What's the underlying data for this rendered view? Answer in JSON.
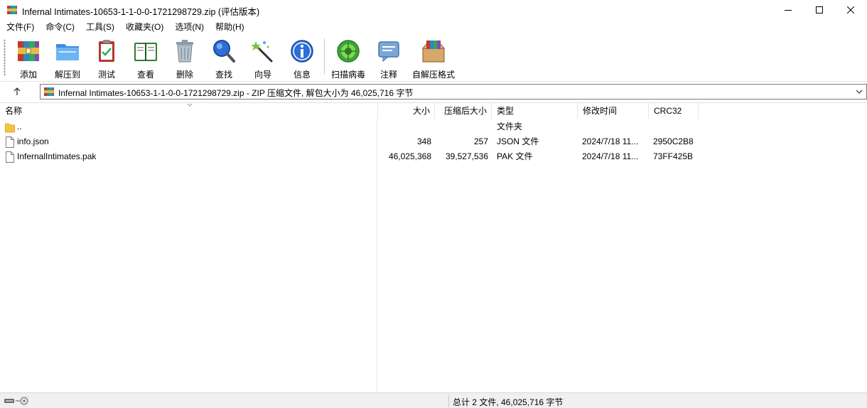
{
  "window": {
    "title": "Infernal Intimates-10653-1-1-0-0-1721298729.zip (评估版本)",
    "app_icon": "winrar-icon",
    "controls": [
      "minimize-icon",
      "maximize-icon",
      "close-icon"
    ]
  },
  "menu": [
    {
      "label": "文件(F)"
    },
    {
      "label": "命令(C)"
    },
    {
      "label": "工具(S)"
    },
    {
      "label": "收藏夹(O)"
    },
    {
      "label": "选项(N)"
    },
    {
      "label": "帮助(H)"
    }
  ],
  "toolbar": {
    "buttons": [
      {
        "label": "添加",
        "icon": "add-archive-icon"
      },
      {
        "label": "解压到",
        "icon": "extract-folder-icon"
      },
      {
        "label": "测试",
        "icon": "test-clipboard-icon"
      },
      {
        "label": "查看",
        "icon": "view-book-icon"
      },
      {
        "label": "删除",
        "icon": "delete-trash-icon"
      },
      {
        "label": "查找",
        "icon": "find-magnifier-icon"
      },
      {
        "label": "向导",
        "icon": "wizard-wand-icon"
      },
      {
        "label": "信息",
        "icon": "info-icon"
      },
      {
        "label": "扫描病毒",
        "icon": "virus-scan-icon"
      },
      {
        "label": "注释",
        "icon": "comment-icon"
      },
      {
        "label": "自解压格式",
        "icon": "sfx-box-icon"
      }
    ]
  },
  "address": {
    "text": "Infernal Intimates-10653-1-1-0-0-1721298729.zip - ZIP 压缩文件, 解包大小为 46,025,716 字节"
  },
  "columns": {
    "name": "名称",
    "size": "大小",
    "packed": "压缩后大小",
    "type": "类型",
    "modified": "修改时间",
    "crc": "CRC32"
  },
  "files": [
    {
      "name": "..",
      "size": "",
      "packed": "",
      "type": "文件夹",
      "modified": "",
      "crc": "",
      "icon": "folder-icon"
    },
    {
      "name": "info.json",
      "size": "348",
      "packed": "257",
      "type": "JSON 文件",
      "modified": "2024/7/18 11...",
      "crc": "2950C2B8",
      "icon": "file-icon"
    },
    {
      "name": "InfernalIntimates.pak",
      "size": "46,025,368",
      "packed": "39,527,536",
      "type": "PAK 文件",
      "modified": "2024/7/18 11...",
      "crc": "73FF425B",
      "icon": "file-icon"
    }
  ],
  "status": {
    "text": "总计 2 文件, 46,025,716 字节"
  },
  "colors": {
    "statusbar_bg": "#f0f0f0",
    "window_bg": "#ffffff",
    "folder": "#f5c342"
  }
}
